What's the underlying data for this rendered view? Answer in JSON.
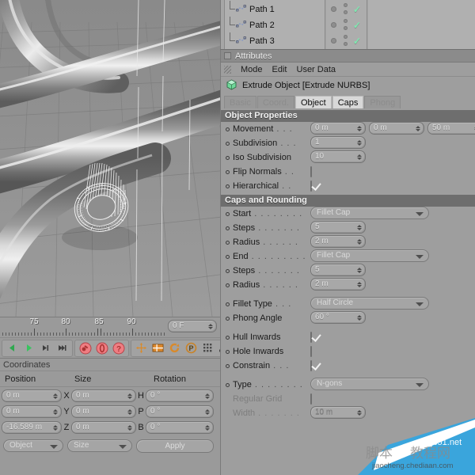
{
  "object_manager": {
    "items": [
      {
        "label": "Path 1",
        "icon": "spline-icon"
      },
      {
        "label": "Path 2",
        "icon": "spline-icon"
      },
      {
        "label": "Path 3",
        "icon": "spline-icon"
      }
    ]
  },
  "attributes": {
    "panel_title": "Attributes",
    "menu": [
      "Mode",
      "Edit",
      "User Data"
    ],
    "object_line": "Extrude Object [Extrude NURBS]",
    "tabs": [
      {
        "label": "Basic",
        "active": false
      },
      {
        "label": "Coord.",
        "active": false
      },
      {
        "label": "Object",
        "active": true
      },
      {
        "label": "Caps",
        "active": true
      },
      {
        "label": "Phong",
        "active": false
      }
    ],
    "sections": [
      {
        "title": "Object Properties",
        "rows": [
          {
            "label": "Movement",
            "dots": ". . .",
            "type": "vector3",
            "values": [
              "0 m",
              "0 m",
              "50 m"
            ]
          },
          {
            "label": "Subdivision",
            "dots": ". . .",
            "type": "number",
            "value": "1"
          },
          {
            "label": "Iso Subdivision",
            "dots": "",
            "type": "number",
            "value": "10"
          },
          {
            "label": "Flip Normals",
            "dots": ". .",
            "type": "checkbox",
            "checked": false
          },
          {
            "label": "Hierarchical",
            "dots": ". .",
            "type": "checkbox",
            "checked": true
          }
        ]
      },
      {
        "title": "Caps and Rounding",
        "rows": [
          {
            "label": "Start",
            "dots": ". . . . . . . .",
            "type": "dropdown",
            "value": "Fillet Cap"
          },
          {
            "label": "Steps",
            "dots": ". . . . . . .",
            "type": "number",
            "value": "5"
          },
          {
            "label": "Radius",
            "dots": ". . . . . .",
            "type": "number",
            "value": "2 m"
          },
          {
            "label": "End",
            "dots": ". . . . . . . . .",
            "type": "dropdown",
            "value": "Fillet Cap"
          },
          {
            "label": "Steps",
            "dots": ". . . . . . .",
            "type": "number",
            "value": "5"
          },
          {
            "label": "Radius",
            "dots": ". . . . . .",
            "type": "number",
            "value": "2 m"
          },
          {
            "label": "",
            "dots": "",
            "type": "spacer"
          },
          {
            "label": "Fillet Type",
            "dots": ". . .",
            "type": "dropdown",
            "value": "Half Circle"
          },
          {
            "label": "Phong Angle",
            "dots": "",
            "type": "number",
            "value": "60 °"
          },
          {
            "label": "",
            "dots": "",
            "type": "spacer"
          },
          {
            "label": "Hull Inwards",
            "dots": "",
            "type": "checkbox",
            "checked": true
          },
          {
            "label": "Hole Inwards",
            "dots": "",
            "type": "checkbox",
            "checked": false
          },
          {
            "label": "Constrain",
            "dots": ". . .",
            "type": "checkbox",
            "checked": true
          },
          {
            "label": "",
            "dots": "",
            "type": "spacer"
          },
          {
            "label": "Type",
            "dots": ". . . . . . . .",
            "type": "dropdown",
            "value": "N-gons"
          },
          {
            "label": "Regular Grid",
            "dots": "",
            "type": "checkbox",
            "checked": false,
            "disabled": true
          },
          {
            "label": "Width",
            "dots": ". . . . . . .",
            "type": "number",
            "value": "10 m",
            "disabled": true
          }
        ]
      }
    ]
  },
  "timeline": {
    "ticks": [
      "75",
      "80",
      "85",
      "90"
    ],
    "current_frame": "0 F"
  },
  "toolbar": {
    "transport": [
      "play-back-icon",
      "play-forward-icon",
      "step-forward-icon",
      "go-to-end-icon"
    ],
    "record": [
      "record-keyframe-icon",
      "autokeying-icon",
      "keyframe-selection-icon"
    ],
    "tools": [
      "move-tool-icon",
      "scale-tool-icon",
      "rotate-tool-icon",
      "parametric-icon",
      "points-icon",
      "magnet-icon",
      "layout-icon"
    ]
  },
  "coordinates": {
    "panel_title": "Coordinates",
    "headers": [
      "Position",
      "Size",
      "Rotation"
    ],
    "rows": [
      {
        "position": "0 m",
        "axis": "X",
        "size": "0 m",
        "rot_label": "H",
        "rotation": "0 °"
      },
      {
        "position": "0 m",
        "axis": "Y",
        "size": "0 m",
        "rot_label": "P",
        "rotation": "0 °"
      },
      {
        "position": "-16.589 m",
        "axis": "Z",
        "size": "0 m",
        "rot_label": "B",
        "rotation": "0 °"
      }
    ],
    "mode_dropdown": "Object",
    "size_dropdown": "Size",
    "apply_button": "Apply"
  },
  "watermark": {
    "line1": "jb51.net",
    "line2": "jiaocheng.chediaan.com",
    "cn1": "脚本",
    "cn2": "教程网"
  },
  "colors": {
    "panel_bg": "#9e9e9e",
    "section_bar": "#6e6e6e",
    "field_bg": "#a8a8a8",
    "accent_check": "#7fe8b0",
    "tool_orange": "#d98a2b",
    "tool_red": "#e8656a"
  }
}
